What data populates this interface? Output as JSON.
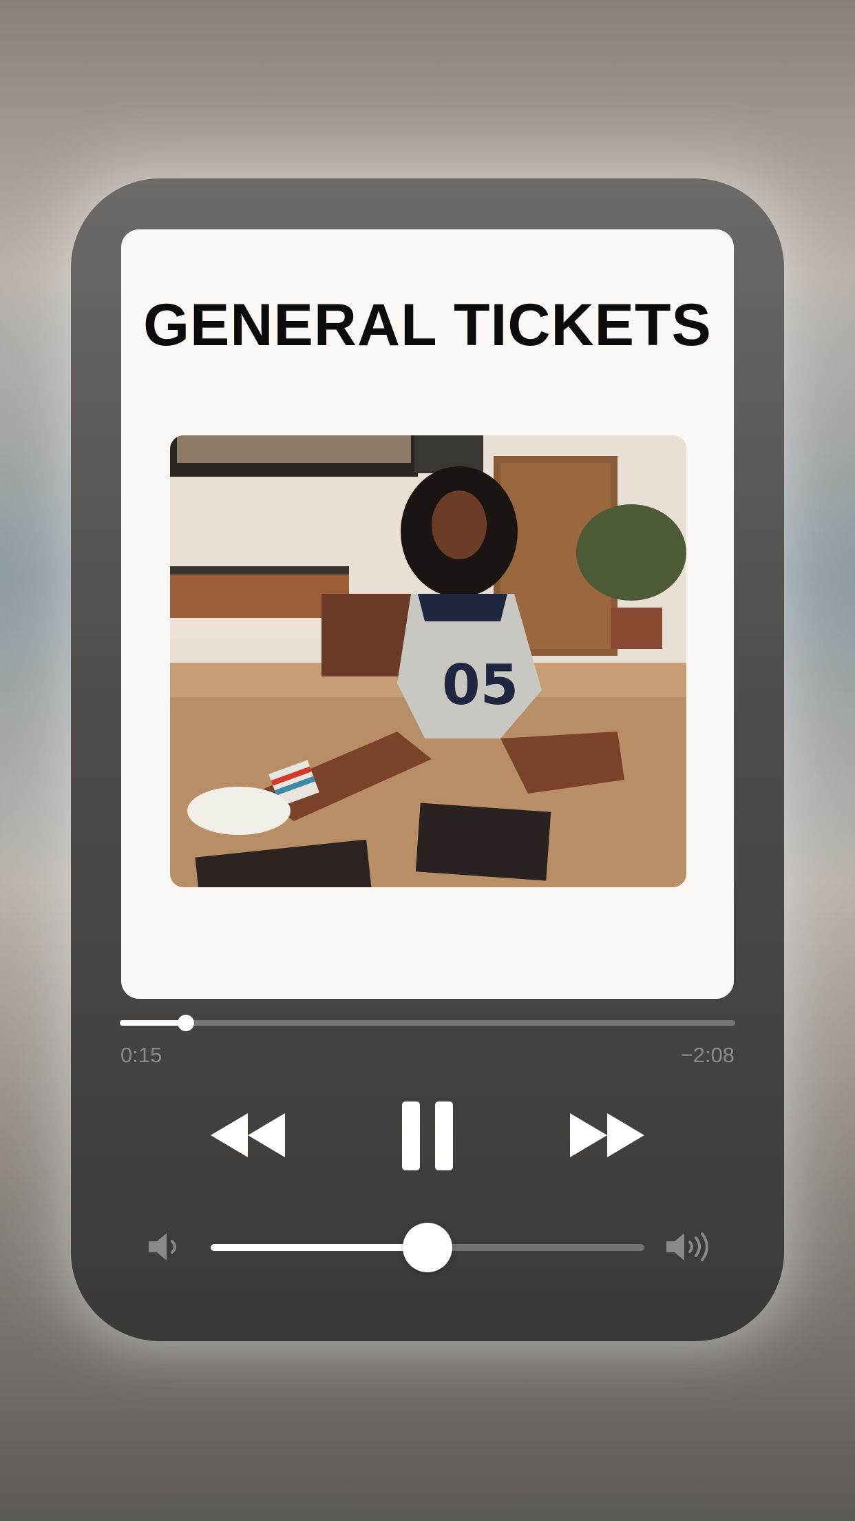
{
  "artwork": {
    "headline": "GENERAL TICKETS"
  },
  "playback": {
    "elapsed": "0:15",
    "remaining": "−2:08",
    "progress_fraction": 0.107,
    "is_playing": true
  },
  "volume": {
    "level_fraction": 0.5
  },
  "icons": {
    "rewind": "rewind-icon",
    "pause": "pause-icon",
    "forward": "fast-forward-icon",
    "volume_low": "speaker-low-icon",
    "volume_high": "speaker-high-icon"
  },
  "colors": {
    "player_background": "#4f4c4a",
    "card_background": "#faf7f5",
    "headline": "#0b0b0b",
    "control": "#ffffff"
  }
}
